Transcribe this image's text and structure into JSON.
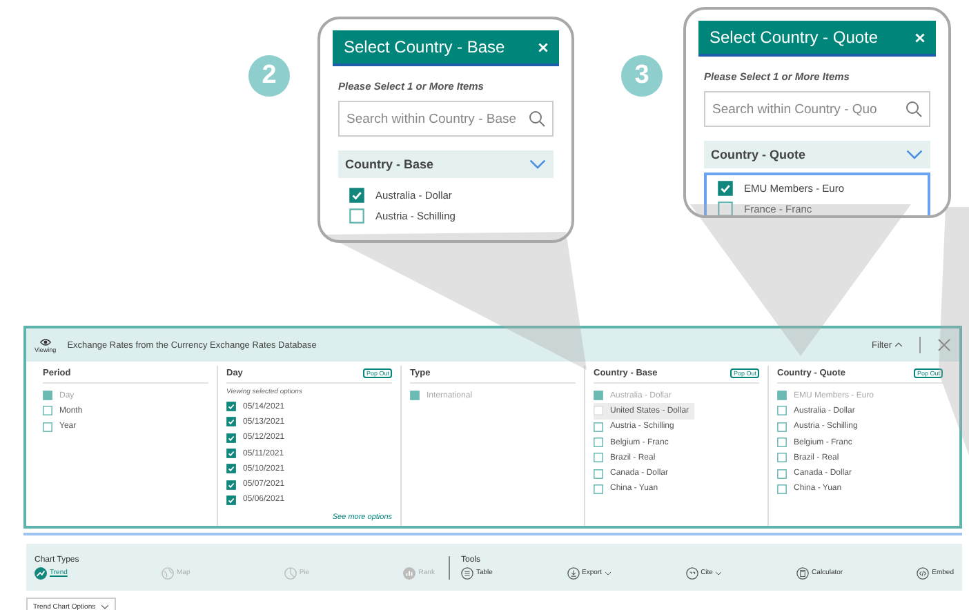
{
  "callouts": [
    {
      "number": "2",
      "title": "Select Country - Base",
      "hint": "Please Select 1 or More Items",
      "search_placeholder": "Search within Country - Base",
      "group": "Country - Base",
      "focused": false,
      "items": [
        {
          "label": "Australia - Dollar",
          "checked": true
        },
        {
          "label": "Austria - Schilling",
          "checked": false
        }
      ]
    },
    {
      "number": "3",
      "title": "Select Country - Quote",
      "hint": "Please Select 1 or More Items",
      "search_placeholder": "Search within Country - Quo",
      "group": "Country - Quote",
      "focused": true,
      "items": [
        {
          "label": "EMU Members - Euro",
          "checked": true
        },
        {
          "label": "France - Franc",
          "checked": false
        }
      ]
    }
  ],
  "panel": {
    "viewing_label": "Viewing",
    "title": "Exchange Rates from the Currency Exchange Rates Database",
    "filter_label": "Filter",
    "columns": [
      {
        "title": "Period",
        "items": [
          {
            "label": "Day",
            "checked": true,
            "disabled": true,
            "highlighted": false
          },
          {
            "label": "Month",
            "checked": false,
            "disabled": false,
            "highlighted": false
          },
          {
            "label": "Year",
            "checked": false,
            "disabled": false,
            "highlighted": false
          }
        ]
      },
      {
        "title": "Day",
        "pop_out": "Pop Out",
        "note": "Viewing selected options",
        "link": "See more options",
        "items": [
          {
            "label": "05/14/2021",
            "checked": true,
            "disabled": false,
            "highlighted": false
          },
          {
            "label": "05/13/2021",
            "checked": true,
            "disabled": false,
            "highlighted": false
          },
          {
            "label": "05/12/2021",
            "checked": true,
            "disabled": false,
            "highlighted": false
          },
          {
            "label": "05/11/2021",
            "checked": true,
            "disabled": false,
            "highlighted": false
          },
          {
            "label": "05/10/2021",
            "checked": true,
            "disabled": false,
            "highlighted": false
          },
          {
            "label": "05/07/2021",
            "checked": true,
            "disabled": false,
            "highlighted": false
          },
          {
            "label": "05/06/2021",
            "checked": true,
            "disabled": false,
            "highlighted": false
          }
        ]
      },
      {
        "title": "Type",
        "items": [
          {
            "label": "International",
            "checked": true,
            "disabled": true,
            "highlighted": false
          }
        ]
      },
      {
        "title": "Country - Base",
        "pop_out": "Pop Out",
        "items": [
          {
            "label": "Australia - Dollar",
            "checked": true,
            "disabled": true,
            "highlighted": false
          },
          {
            "label": "United States - Dollar",
            "checked": false,
            "disabled": false,
            "highlighted": true
          },
          {
            "label": "Austria - Schilling",
            "checked": false,
            "disabled": false,
            "highlighted": false
          },
          {
            "label": "Belgium - Franc",
            "checked": false,
            "disabled": false,
            "highlighted": false
          },
          {
            "label": "Brazil - Real",
            "checked": false,
            "disabled": false,
            "highlighted": false
          },
          {
            "label": "Canada - Dollar",
            "checked": false,
            "disabled": false,
            "highlighted": false
          },
          {
            "label": "China - Yuan",
            "checked": false,
            "disabled": false,
            "highlighted": false
          }
        ]
      },
      {
        "title": "Country - Quote",
        "pop_out": "Pop Out",
        "items": [
          {
            "label": "EMU Members - Euro",
            "checked": true,
            "disabled": true,
            "highlighted": false
          },
          {
            "label": "Australia - Dollar",
            "checked": false,
            "disabled": false,
            "highlighted": false
          },
          {
            "label": "Austria - Schilling",
            "checked": false,
            "disabled": false,
            "highlighted": false
          },
          {
            "label": "Belgium - Franc",
            "checked": false,
            "disabled": false,
            "highlighted": false
          },
          {
            "label": "Brazil - Real",
            "checked": false,
            "disabled": false,
            "highlighted": false
          },
          {
            "label": "Canada - Dollar",
            "checked": false,
            "disabled": false,
            "highlighted": false
          },
          {
            "label": "China - Yuan",
            "checked": false,
            "disabled": false,
            "highlighted": false
          }
        ]
      }
    ]
  },
  "toolbar": {
    "chart_types_label": "Chart Types",
    "chart_types": [
      {
        "kind": "trend",
        "label": "Trend",
        "selected": true,
        "disabled": false
      },
      {
        "kind": "map",
        "label": "Map",
        "selected": false,
        "disabled": true
      },
      {
        "kind": "pie",
        "label": "Pie",
        "selected": false,
        "disabled": true
      },
      {
        "kind": "rank",
        "label": "Rank",
        "selected": false,
        "disabled": true
      }
    ],
    "tools_label": "Tools",
    "tools": [
      {
        "kind": "table",
        "label": "Table",
        "dropdown": false
      },
      {
        "kind": "export",
        "label": "Export",
        "dropdown": true
      },
      {
        "kind": "cite",
        "label": "Cite",
        "dropdown": true
      },
      {
        "kind": "calculator",
        "label": "Calculator",
        "dropdown": false
      },
      {
        "kind": "embed",
        "label": "Embed",
        "dropdown": false
      }
    ]
  },
  "chart_options": "Trend Chart Options"
}
